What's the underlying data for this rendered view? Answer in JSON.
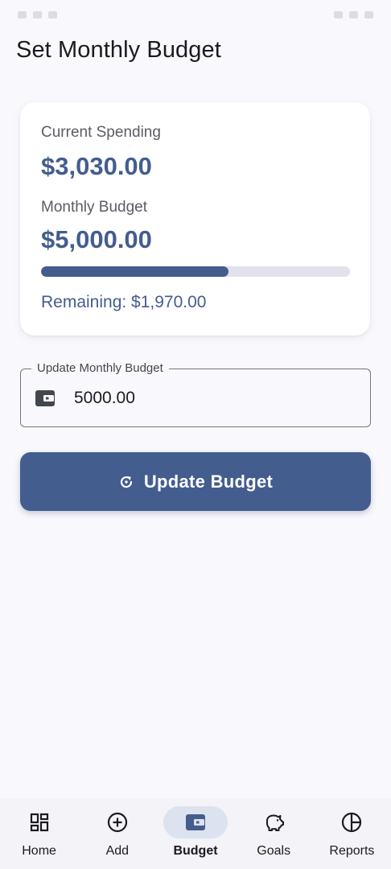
{
  "page": {
    "title": "Set Monthly Budget"
  },
  "summary": {
    "current_spending_label": "Current Spending",
    "current_spending_value": "$3,030.00",
    "monthly_budget_label": "Monthly Budget",
    "monthly_budget_value": "$5,000.00",
    "progress_fraction": 0.606,
    "remaining_text": "Remaining: $1,970.00"
  },
  "budget_field": {
    "label": "Update Monthly Budget",
    "value": "5000.00",
    "icon": "wallet-icon"
  },
  "update_button": {
    "label": "Update Budget",
    "icon": "refresh-icon"
  },
  "nav": {
    "items": [
      {
        "label": "Home",
        "icon": "dashboard-icon",
        "active": false
      },
      {
        "label": "Add",
        "icon": "add-circle-icon",
        "active": false
      },
      {
        "label": "Budget",
        "icon": "wallet-icon",
        "active": true
      },
      {
        "label": "Goals",
        "icon": "piggy-bank-icon",
        "active": false
      },
      {
        "label": "Reports",
        "icon": "pie-chart-icon",
        "active": false
      }
    ]
  },
  "colors": {
    "primary": "#445d8f",
    "background": "#f9f9fd",
    "track": "#e1e2ec",
    "nav_active_pill": "#dde2f0"
  }
}
